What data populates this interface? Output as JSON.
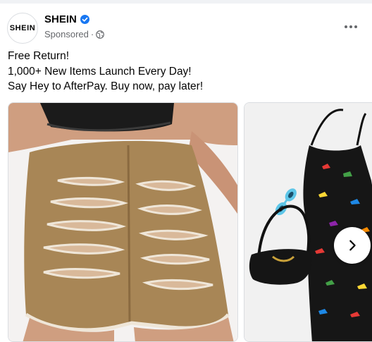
{
  "post": {
    "avatar_text": "SHEIN",
    "page_name": "SHEIN",
    "sponsored_label": "Sponsored",
    "separator": "·",
    "text_lines": [
      "Free Return!",
      "1,000+ New Items Launch Every Day!",
      "Say Hey to AfterPay. Buy now, pay later!"
    ]
  },
  "icons": {
    "verified": "verified-badge-icon",
    "audience": "globe-icon",
    "more": "more-options-icon",
    "next": "chevron-right-icon"
  },
  "colors": {
    "verified_blue": "#1877f2",
    "secondary_text": "#65676b",
    "border": "#dadde1"
  },
  "carousel": {
    "cards": [
      {
        "image": "ripped-denim-shorts-photo"
      },
      {
        "image": "dinosaur-print-romper-with-bag-photo"
      }
    ]
  }
}
